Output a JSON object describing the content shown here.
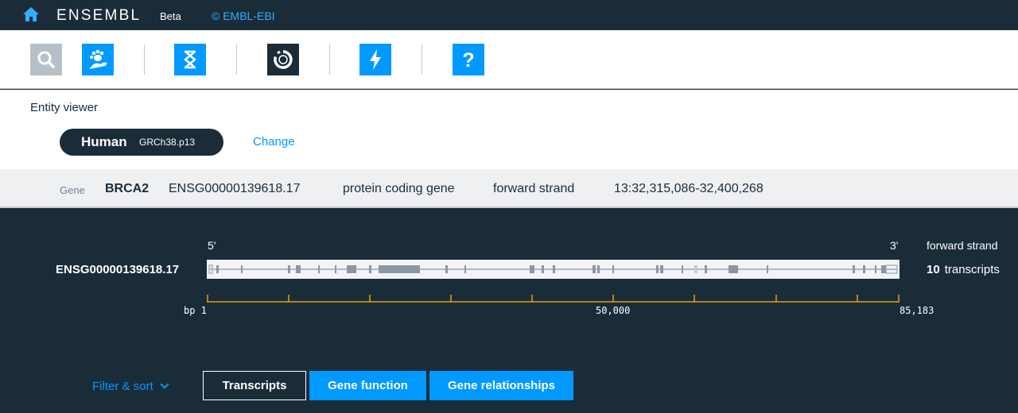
{
  "header": {
    "brand": "ENSEMBL",
    "beta": "Beta",
    "copyright": "© EMBL-EBI",
    "home_icon": "home-icon"
  },
  "launchbar": {
    "apps": [
      {
        "name": "search",
        "icon": "magnifier-icon",
        "active": true
      },
      {
        "name": "species-selector",
        "icon": "paw-leaf-icon",
        "active": false
      },
      {
        "name": "genome-browser",
        "icon": "dna-helix-icon",
        "active": false
      },
      {
        "name": "entity-viewer",
        "icon": "circular-viewer-icon",
        "active": true
      },
      {
        "name": "tools",
        "icon": "lightning-icon",
        "active": false
      },
      {
        "name": "help",
        "icon": "question-icon",
        "active": false
      }
    ],
    "colors": {
      "blue": "#0099ff",
      "grey": "#b7c0c8",
      "dark": "#1b2c39"
    }
  },
  "app_bar": {
    "app_name": "Entity viewer",
    "species": {
      "name": "Human",
      "assembly": "GRCh38.p13"
    },
    "change_label": "Change"
  },
  "gene_summary": {
    "label": "Gene",
    "symbol": "BRCA2",
    "stable_id": "ENSG00000139618.17",
    "biotype": "protein coding gene",
    "strand": "forward strand",
    "location": "13:32,315,086-32,400,268"
  },
  "overview": {
    "five_prime": "5'",
    "three_prime": "3'",
    "strand_label": "forward strand",
    "gene_id": "ENSG00000139618.17",
    "transcript_count": "10",
    "transcripts_label": "transcripts",
    "ruler": {
      "start_label": "bp 1",
      "mid_label": "50,000",
      "end_label": "85,183",
      "length_bp": 85183,
      "tick_interval_bp": 10000
    },
    "colors": {
      "track_bg": "#f2f3f5",
      "exon": "#8a97a3",
      "intron": "#8a97a3",
      "ruler": "#e5a008"
    }
  },
  "controls": {
    "filter_sort": "Filter & sort",
    "tabs": [
      {
        "label": "Transcripts",
        "selected": true
      },
      {
        "label": "Gene function",
        "selected": false
      },
      {
        "label": "Gene relationships",
        "selected": false
      }
    ]
  }
}
